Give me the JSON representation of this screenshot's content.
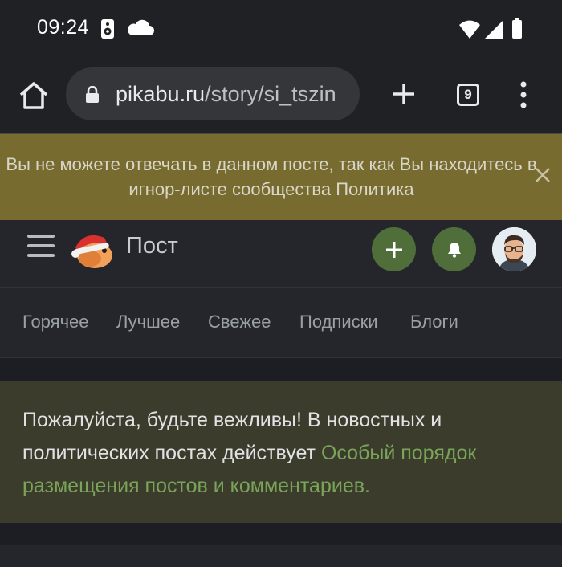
{
  "status_bar": {
    "time": "09:24",
    "left_icons": [
      "speaker-icon",
      "cloud-icon"
    ],
    "right_icons": [
      "wifi-icon",
      "cell-signal-icon",
      "battery-icon"
    ]
  },
  "browser": {
    "url_domain": "pikabu.ru",
    "url_path": "/story/si_tszin",
    "tab_count": "9",
    "icons": [
      "home-icon",
      "lock-icon",
      "plus-icon",
      "tab-switcher-icon",
      "kebab-menu-icon"
    ]
  },
  "ignore_banner": {
    "text": "Вы не можете отвечать в данном посте, так как Вы находитесь в игнор-листе сообщества Политика",
    "close_icon": "close-icon"
  },
  "header": {
    "title": "Пост",
    "icons": [
      "hamburger-icon",
      "pikabu-logo",
      "plus-icon",
      "bell-icon",
      "user-avatar"
    ]
  },
  "nav": {
    "tabs": [
      {
        "label": "Горячее"
      },
      {
        "label": "Лучшее"
      },
      {
        "label": "Свежее"
      },
      {
        "label": "Подписки"
      },
      {
        "label": "Блоги"
      }
    ]
  },
  "notice": {
    "text_before": "Пожалуйста, будьте вежливы! В новостных и политических постах действует ",
    "link_text": "Особый порядок размещения постов и комментариев."
  },
  "colors": {
    "banner_bg": "#786b2f",
    "notice_bg": "#3c3c2c",
    "accent_green": "#4f6e3a",
    "link_green": "#7aa45a"
  }
}
